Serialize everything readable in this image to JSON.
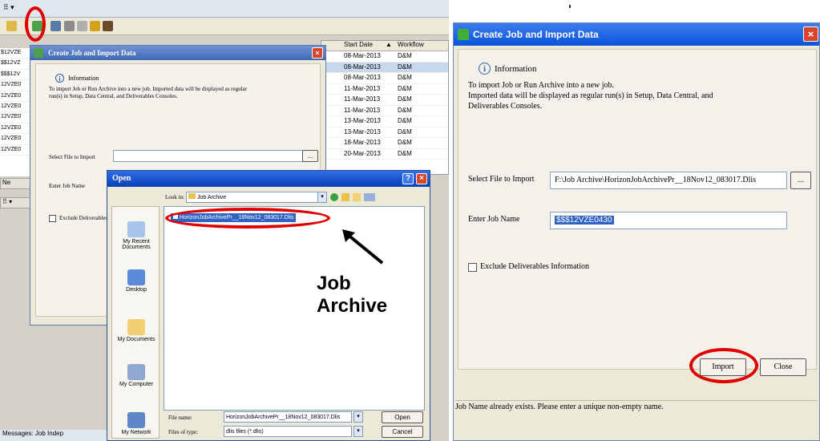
{
  "left": {
    "grid": {
      "headers": [
        "Start Date",
        "▲",
        "Workflow"
      ],
      "rows": [
        {
          "date": "08-Mar-2013",
          "wf": "D&M"
        },
        {
          "date": "08-Mar-2013",
          "wf": "D&M"
        },
        {
          "date": "08-Mar-2013",
          "wf": "D&M"
        },
        {
          "date": "11-Mar-2013",
          "wf": "D&M"
        },
        {
          "date": "11-Mar-2013",
          "wf": "D&M"
        },
        {
          "date": "11-Mar-2013",
          "wf": "D&M"
        },
        {
          "date": "13-Mar-2013",
          "wf": "D&M"
        },
        {
          "date": "13-Mar-2013",
          "wf": "D&M"
        },
        {
          "date": "18-Mar-2013",
          "wf": "D&M"
        },
        {
          "date": "20-Mar-2013",
          "wf": "D&M"
        }
      ]
    },
    "job_column": [
      "$12VZE",
      "$$12VZ",
      "$$$12V",
      "12VZE0",
      "12VZE0",
      "12VZE0",
      "12VZE0",
      "12VZE0",
      "12VZE0",
      "12VZE0"
    ],
    "new_button": "Ne",
    "bottom_tab": "Messages: Job Indep",
    "create_dialog": {
      "title": "Create Job and Import Data",
      "info_heading": "Information",
      "info_text": "To import Job or Run Archive into a new job. Imported data will be displayed as regular run(s) in Setup, Data Central, and Deliverables Consoles.",
      "select_file_label": "Select File to Import",
      "browse_label": "...",
      "job_name_label": "Enter Job Name",
      "exclude_label": "Exclude Deliverables",
      "close_icon": "close-icon"
    },
    "open_dialog": {
      "title": "Open",
      "help_label": "?",
      "look_in_label": "Look in:",
      "look_in_value": "Job Archive",
      "selected_file": "HorizonJobArchivePr__18Nov12_083017.Dlis",
      "places": [
        "My Recent Documents",
        "Desktop",
        "My Documents",
        "My Computer",
        "My Network"
      ],
      "file_name_label": "File name:",
      "file_name_value": "HorizonJobArchivePr__18Nov12_083017.Dlis",
      "file_type_label": "Files of type:",
      "file_type_value": "dlis files (*.dlis)",
      "open_button": "Open",
      "cancel_button": "Cancel"
    },
    "annotation": "Job Archive"
  },
  "right": {
    "title": "Create Job and Import Data",
    "info_heading": "Information",
    "info_line1": "To import Job or Run Archive into a new job.",
    "info_line2": "Imported data will be displayed as regular run(s) in Setup, Data Central, and",
    "info_line3": "Deliverables Consoles.",
    "select_file_label": "Select File to Import",
    "select_file_value": "F:\\Job Archive\\HorizonJobArchivePr__18Nov12_083017.Dlis",
    "browse_label": "...",
    "job_name_label": "Enter Job Name",
    "job_name_value": "$$$12VZE0430",
    "exclude_label": "Exclude Deliverables Information",
    "import_button": "Import",
    "close_button": "Close",
    "status": "Job Name already exists. Please enter a unique non-empty name."
  },
  "colors": {
    "annotation_red": "#e00000",
    "title_blue": "#0a54d9"
  }
}
